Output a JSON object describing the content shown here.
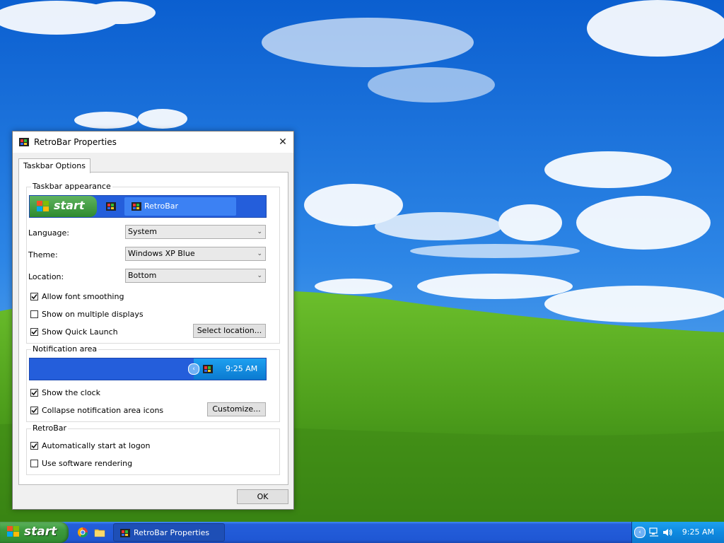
{
  "dialog": {
    "title": "RetroBar Properties",
    "close_glyph": "✕",
    "tab_label": "Taskbar Options",
    "appearance_group": {
      "title": "Taskbar appearance",
      "preview_start_label": "start",
      "preview_task_label": "RetroBar",
      "language_label": "Language:",
      "language_value": "System",
      "theme_label": "Theme:",
      "theme_value": "Windows XP Blue",
      "location_label": "Location:",
      "location_value": "Bottom",
      "checkboxes": [
        {
          "label": "Allow font smoothing",
          "checked": true
        },
        {
          "label": "Show on multiple displays",
          "checked": false
        },
        {
          "label": "Show Quick Launch",
          "checked": true
        }
      ],
      "select_location_button": "Select location..."
    },
    "notification_group": {
      "title": "Notification area",
      "preview_clock": "9:25 AM",
      "checkboxes": [
        {
          "label": "Show the clock",
          "checked": true
        },
        {
          "label": "Collapse notification area icons",
          "checked": true
        }
      ],
      "customize_button": "Customize..."
    },
    "retrobar_group": {
      "title": "RetroBar",
      "checkboxes": [
        {
          "label": "Automatically start at logon",
          "checked": true
        },
        {
          "label": "Use software rendering",
          "checked": false
        }
      ]
    },
    "ok_button": "OK"
  },
  "taskbar": {
    "start_label": "start",
    "quick_launch": [
      "chrome-icon",
      "folder-icon"
    ],
    "task_button_label": "RetroBar Properties",
    "clock": "9:25 AM",
    "tray_icons": [
      "chevron-left-icon",
      "network-icon",
      "volume-icon"
    ]
  },
  "colors": {
    "sky": "#1f74d9",
    "grass": "#4c9b1e",
    "xp_blue": "#245edb",
    "start_green": "#3c9a3c",
    "tray_blue": "#0f8ae0"
  }
}
